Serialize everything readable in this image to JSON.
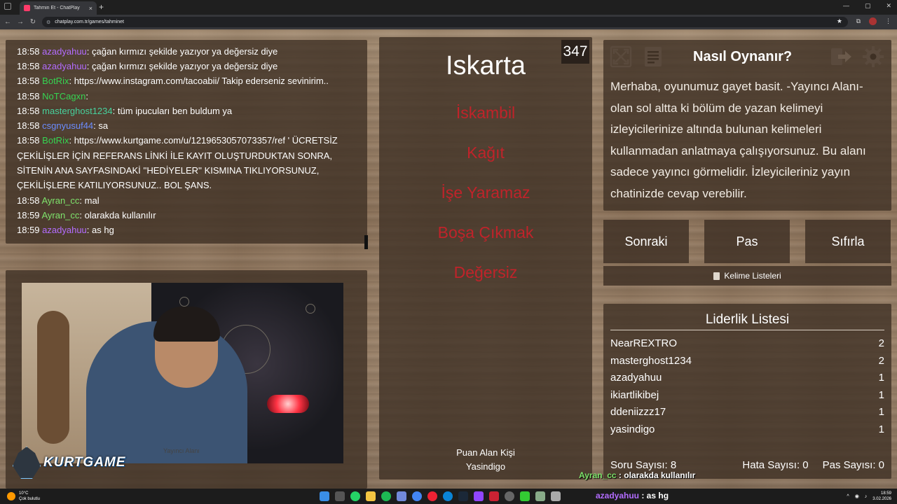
{
  "browser": {
    "tab_title": "Tahmin Et - ChatPlay",
    "tab_close": "×",
    "new_tab": "+",
    "url": "chatplay.com.tr/games/tahminet",
    "window_controls": [
      "—",
      "▢",
      "✕"
    ]
  },
  "chat": {
    "messages": [
      {
        "time": "18:58",
        "user": "azadyahuu",
        "color": "#b36cff",
        "text": ": çağan kırmızı şekilde yazıyor ya değersiz diye"
      },
      {
        "time": "18:58",
        "user": "azadyahuu",
        "color": "#b36cff",
        "text": ": çağan kırmızı şekilde yazıyor ya değersiz diye"
      },
      {
        "time": "18:58",
        "user": "BotRix",
        "color": "#36d452",
        "text": ": https://www.instagram.com/tacoabii/ Takip ederseniz sevinirim.."
      },
      {
        "time": "18:58",
        "user": "NoTCagxn",
        "color": "#36d452",
        "text": ": "
      },
      {
        "time": "18:58",
        "user": "masterghost1234",
        "color": "#47d19d",
        "text": ": tüm ipucuları ben buldum ya"
      },
      {
        "time": "18:58",
        "user": "csgnyusuf44",
        "color": "#6b8cff",
        "text": ": sa"
      },
      {
        "time": "18:58",
        "user": "BotRix",
        "color": "#36d452",
        "text": ": https://www.kurtgame.com/u/1219653057073357/ref ' ÜCRETSİZ ÇEKİLİŞLER İÇİN REFERANS LİNKİ İLE KAYIT OLUŞTURDUKTAN SONRA, SİTENİN ANA SAYFASINDAKİ ''HEDİYELER'' KISMINA TIKLIYORSUNUZ, ÇEKİLİŞLERE KATILIYORSUNUZ.. BOL ŞANS."
      },
      {
        "time": "18:58",
        "user": "Ayran_cc",
        "color": "#7ee36b",
        "text": ": mal"
      },
      {
        "time": "18:59",
        "user": "Ayran_cc",
        "color": "#7ee36b",
        "text": ": olarakda kullanılır"
      },
      {
        "time": "18:59",
        "user": "azadyahuu",
        "color": "#b36cff",
        "text": ": as hg"
      }
    ]
  },
  "webcam": {
    "logo_text": "KURTGAME",
    "caption": "Yayıncı Alanı"
  },
  "word": {
    "title": "Iskarta",
    "counter": "347",
    "taboo_words": [
      "İskambil",
      "Kağıt",
      "İşe Yaramaz",
      "Boşa Çıkmak",
      "Değersiz"
    ],
    "taboo_color": "#c0232a",
    "scorer_label": "Puan Alan Kişi",
    "scorer_name": "Yasindigo"
  },
  "help": {
    "title": "Nasıl Oynanır?",
    "text": "Merhaba, oyunumuz gayet basit. -Yayıncı Alanı- olan sol altta ki bölüm de yazan kelimeyi izleyicilerinize altında bulunan kelimeleri kullanmadan anlatmaya çalışıyorsunuz. Bu alanı sadece yayıncı görmelidir. İzleyicileriniz yayın chatinizde cevap verebilir.",
    "icons": [
      "fullscreen-icon",
      "document-icon",
      "exit-icon",
      "gear-icon"
    ]
  },
  "controls": {
    "next": "Sonraki",
    "pass": "Pas",
    "reset": "Sıfırla",
    "word_lists": "Kelime Listeleri"
  },
  "leaderboard": {
    "title": "Liderlik Listesi",
    "rows": [
      {
        "name": "NearREXTRO",
        "score": "2"
      },
      {
        "name": "masterghost1234",
        "score": "2"
      },
      {
        "name": "azadyahuu",
        "score": "1"
      },
      {
        "name": "ikiartlikibej",
        "score": "1"
      },
      {
        "name": "ddeniizzz17",
        "score": "1"
      },
      {
        "name": "yasindigo",
        "score": "1"
      }
    ],
    "question_count": "Soru Sayısı: 8",
    "error_count": "Hata Sayısı: 0",
    "pass_count": "Pas Sayısı: 0"
  },
  "overlay": {
    "ticker_user": "Ayran_cc",
    "ticker_msg": " : olarakda kullanılır"
  },
  "taskbar": {
    "weather_temp": "10°C",
    "weather_desc": "Çok bulutlu",
    "ticker_user": "azadyahuu",
    "ticker_msg": " : as hg",
    "time": "18:59",
    "date": "3.02.2026"
  }
}
